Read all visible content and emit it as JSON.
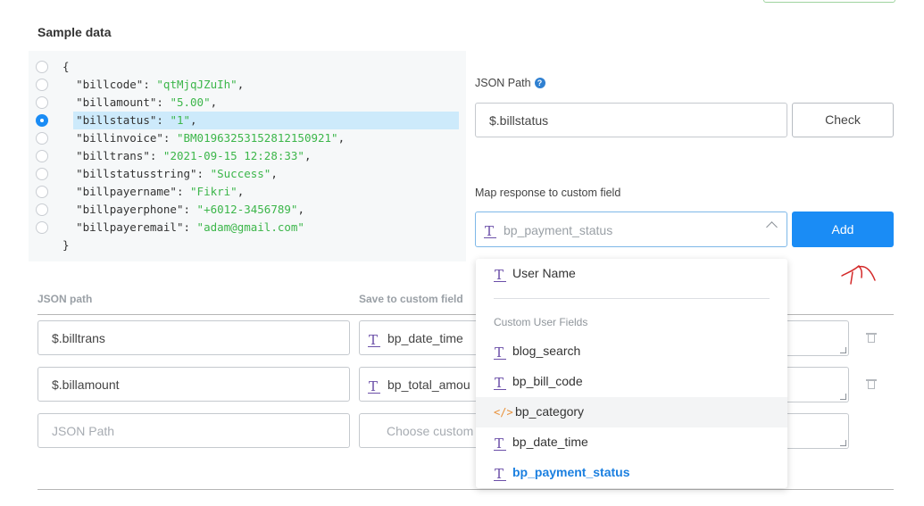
{
  "sample": {
    "title": "Sample data",
    "open_brace": "{",
    "close_brace": "}",
    "lines": [
      {
        "key": "\"billcode\"",
        "value": "\"qtMjqJZuIh\"",
        "trail": ","
      },
      {
        "key": "\"billamount\"",
        "value": "\"5.00\"",
        "trail": ","
      },
      {
        "key": "\"billstatus\"",
        "value": "\"1\"",
        "trail": ","
      },
      {
        "key": "\"billinvoice\"",
        "value": "\"BM01963253152812150921\"",
        "trail": ","
      },
      {
        "key": "\"billtrans\"",
        "value": "\"2021-09-15 12:28:33\"",
        "trail": ","
      },
      {
        "key": "\"billstatusstring\"",
        "value": "\"Success\"",
        "trail": ","
      },
      {
        "key": "\"billpayername\"",
        "value": "\"Fikri\"",
        "trail": ","
      },
      {
        "key": "\"billpayerphone\"",
        "value": "\"+6012-3456789\"",
        "trail": ","
      },
      {
        "key": "\"billpayeremail\"",
        "value": "\"adam@gmail.com\"",
        "trail": ""
      }
    ],
    "selected_index": 3
  },
  "json_path": {
    "label": "JSON Path",
    "help": "?",
    "value": "$.billstatus",
    "check_label": "Check"
  },
  "map": {
    "label": "Map response to custom field",
    "selected": "bp_payment_status",
    "add_label": "Add"
  },
  "table": {
    "col_path": "JSON path",
    "col_field": "Save to custom field",
    "rows": [
      {
        "path": "$.billtrans",
        "field": "bp_date_time"
      },
      {
        "path": "$.billamount",
        "field": "bp_total_amou"
      }
    ],
    "new_row": {
      "path_placeholder": "JSON Path",
      "field_placeholder": "Choose custom"
    }
  },
  "dropdown": {
    "top_item": "User Name",
    "group_label": "Custom User Fields",
    "items": [
      {
        "label": "blog_search",
        "icon": "text-field-icon"
      },
      {
        "label": "bp_bill_code",
        "icon": "text-field-icon"
      },
      {
        "label": "bp_category",
        "icon": "code-icon"
      },
      {
        "label": "bp_date_time",
        "icon": "text-field-icon"
      },
      {
        "label": "bp_payment_status",
        "icon": "text-field-icon"
      }
    ]
  },
  "colors": {
    "accent": "#1a8cf5",
    "selected_row": "#cdeafb",
    "json_value": "#3cb64a"
  }
}
